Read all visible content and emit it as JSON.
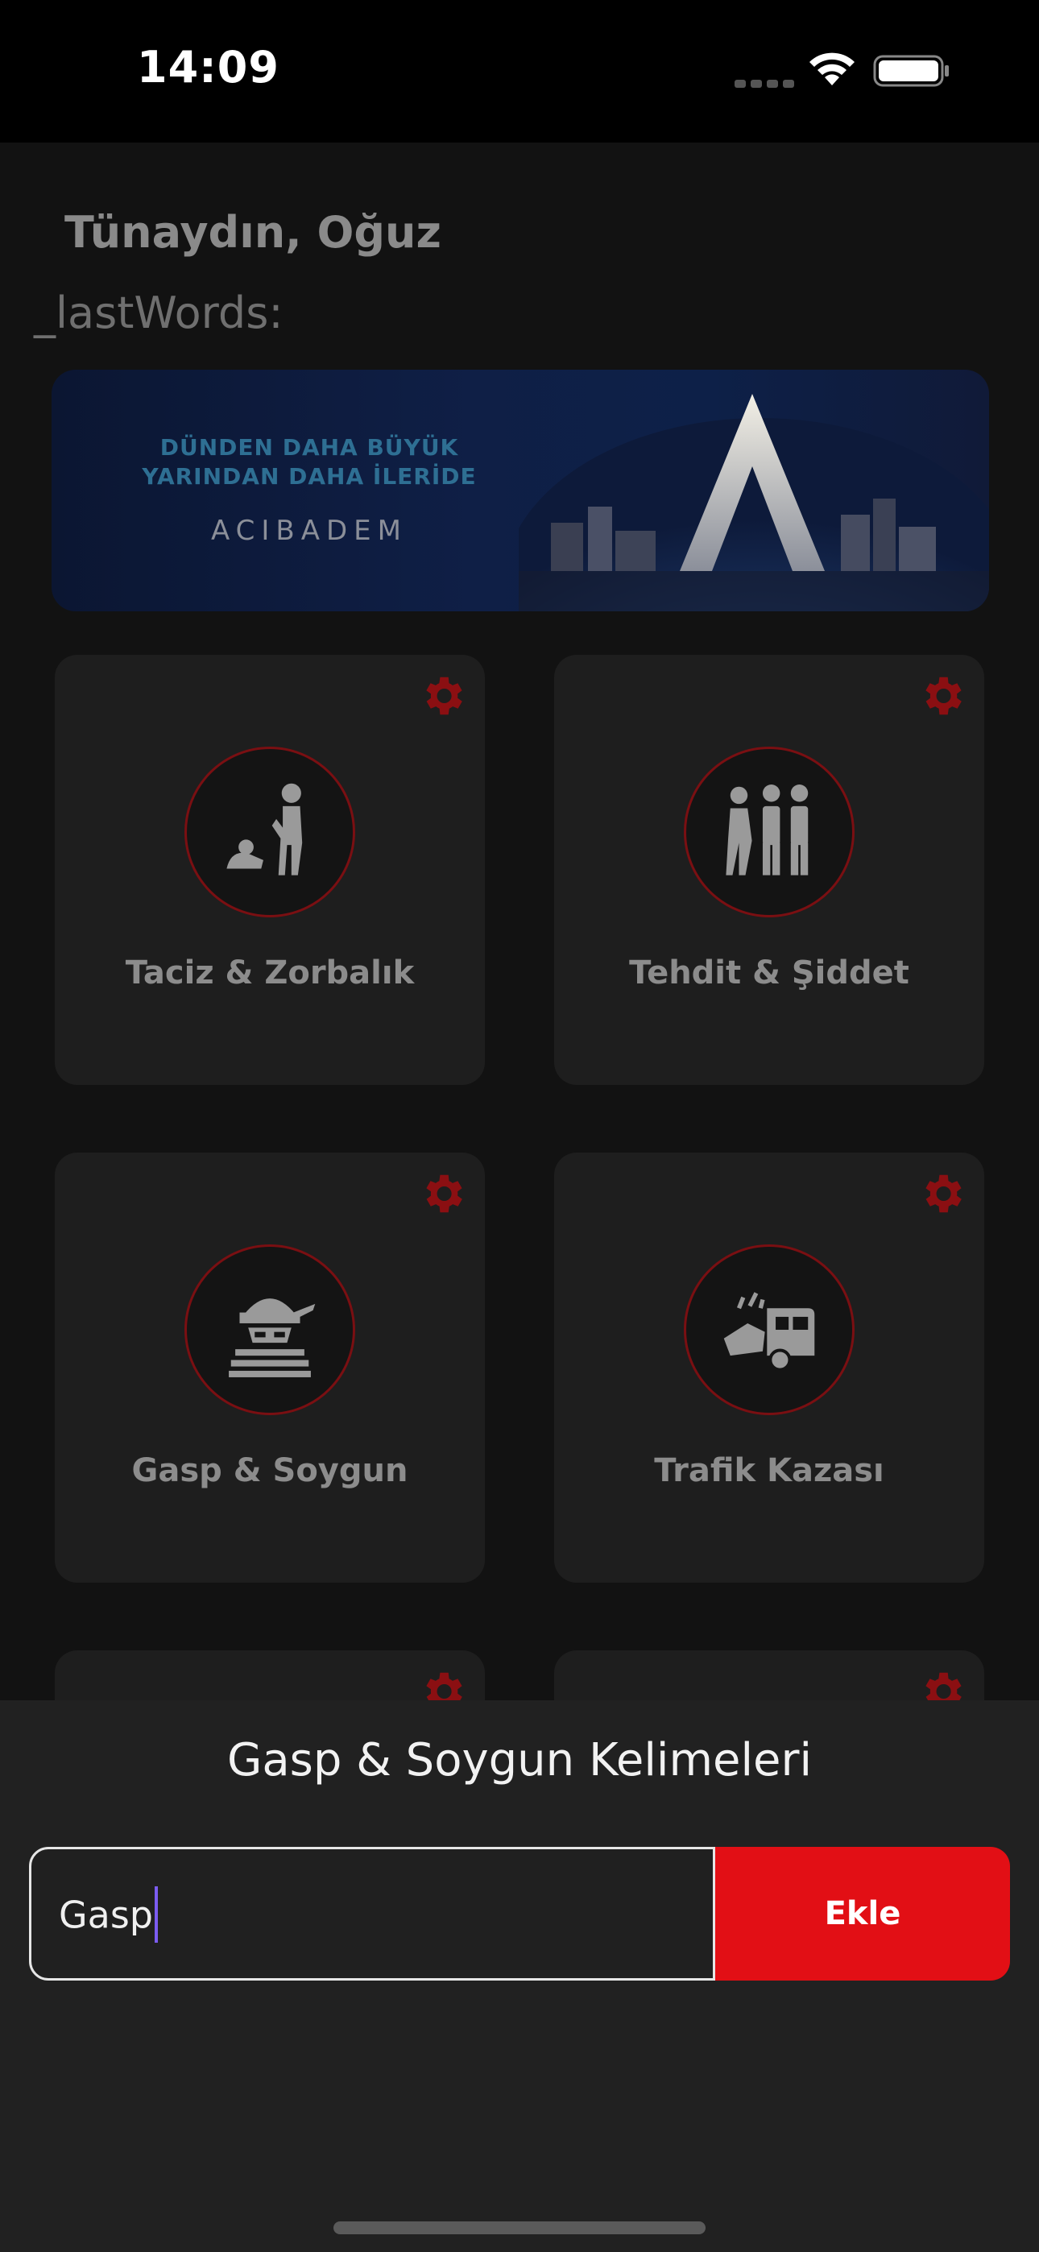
{
  "status_bar": {
    "time": "14:09",
    "icons": [
      "cellular-icon",
      "wifi-icon",
      "battery-icon"
    ]
  },
  "header": {
    "greeting": "Tünaydın, Oğuz",
    "last_words_label": "_lastWords:"
  },
  "banner": {
    "line1": "DÜNDEN DAHA BÜYÜK",
    "line2": "YARINDAN DAHA İLERİDE",
    "brand": "ACIBADEM"
  },
  "categories": [
    {
      "label": "Taciz & Zorbalık",
      "icon": "harassment-icon"
    },
    {
      "label": "Tehdit & Şiddet",
      "icon": "threat-icon"
    },
    {
      "label": "Gasp & Soygun",
      "icon": "robber-icon"
    },
    {
      "label": "Trafik Kazası",
      "icon": "car-crash-icon"
    }
  ],
  "sheet": {
    "title": "Gasp & Soygun Kelimeleri",
    "input_value": "Gasp",
    "add_label": "Ekle"
  },
  "colors": {
    "accent_red": "#e20f15",
    "gear_red": "#8b0f12",
    "background": "#121212",
    "sheet_bg": "#212121"
  }
}
